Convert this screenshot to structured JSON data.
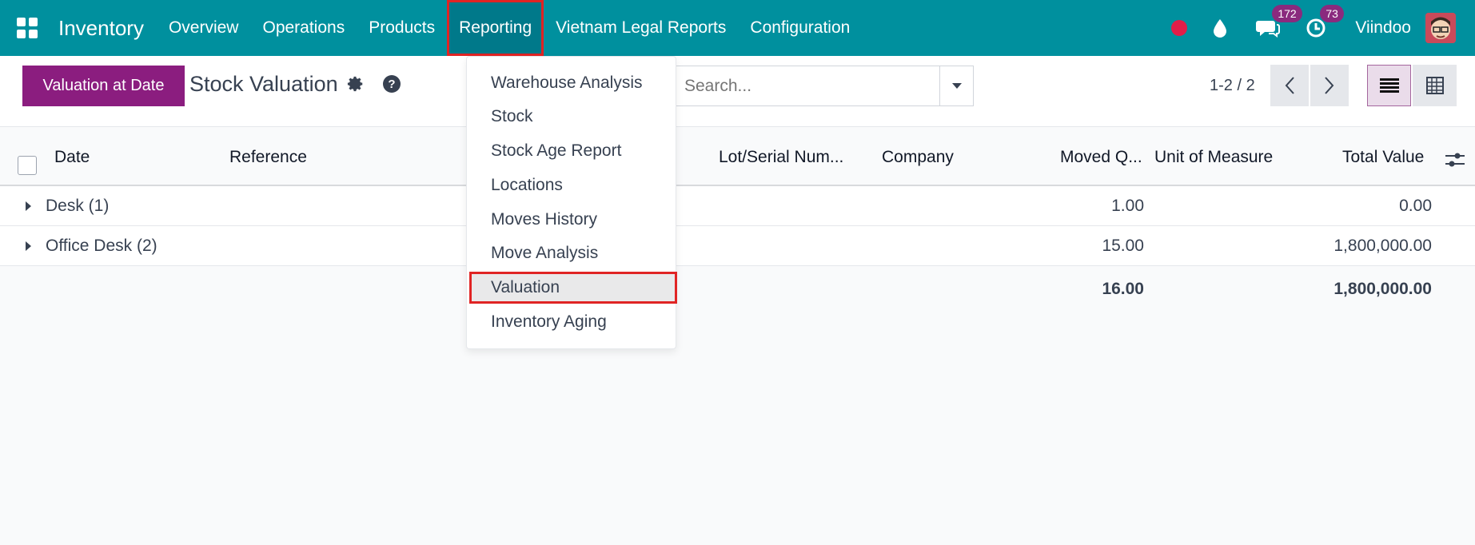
{
  "navbar": {
    "app_name": "Inventory",
    "menu": [
      "Overview",
      "Operations",
      "Products",
      "Reporting",
      "Vietnam Legal Reports",
      "Configuration"
    ],
    "active_menu": "Reporting",
    "messages_count": "172",
    "activities_count": "73",
    "user_name": "Viindoo",
    "colors": {
      "bar": "#00909e",
      "badge": "#8a2a7e",
      "record": "#e11d48"
    }
  },
  "control": {
    "primary_button": "Valuation at Date",
    "title": "Stock Valuation",
    "search_placeholder": "Search...",
    "pager": "1-2 / 2"
  },
  "table": {
    "columns": [
      "Date",
      "Reference",
      "Lot/Serial Num...",
      "Company",
      "Moved Q...",
      "Unit of Measure",
      "Total Value"
    ],
    "rows": [
      {
        "name": "Desk (1)",
        "moved_qty": "1.00",
        "total_value": "0.00"
      },
      {
        "name": "Office Desk (2)",
        "moved_qty": "15.00",
        "total_value": "1,800,000.00"
      }
    ],
    "totals": {
      "moved_qty": "16.00",
      "total_value": "1,800,000.00"
    }
  },
  "reporting_menu": {
    "items": [
      "Warehouse Analysis",
      "Stock",
      "Stock Age Report",
      "Locations",
      "Moves History",
      "Move Analysis",
      "Valuation",
      "Inventory Aging"
    ],
    "active_item": "Valuation"
  }
}
